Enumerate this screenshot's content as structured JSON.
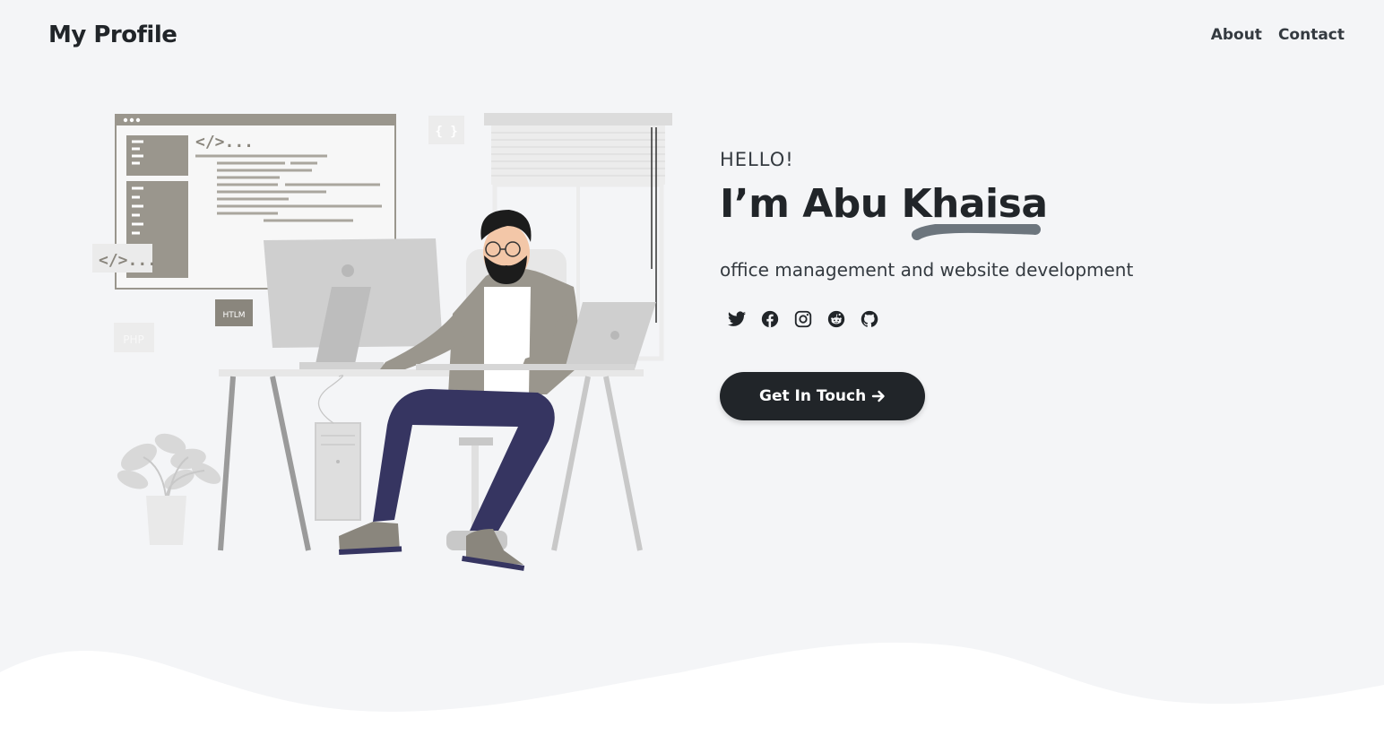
{
  "nav": {
    "brand": "My Profile",
    "links": [
      "About",
      "Contact"
    ]
  },
  "hero": {
    "greeting": "HELLO!",
    "name": "I’m Abu Khaisa",
    "subtitle": "office management and website development",
    "cta_label": "Get In Touch",
    "socials": [
      "twitter-icon",
      "facebook-icon",
      "instagram-icon",
      "reddit-icon",
      "github-icon"
    ]
  },
  "illustration": {
    "code_tag_main": "</>...",
    "code_tag_side": "</>...",
    "braces": "{ }",
    "htlm_badge": "HTLM",
    "php_badge": "PHP"
  },
  "colors": {
    "background": "#f4f5f7",
    "dark": "#212529",
    "accent_swoosh": "#6c757d",
    "pants": "#363561"
  }
}
